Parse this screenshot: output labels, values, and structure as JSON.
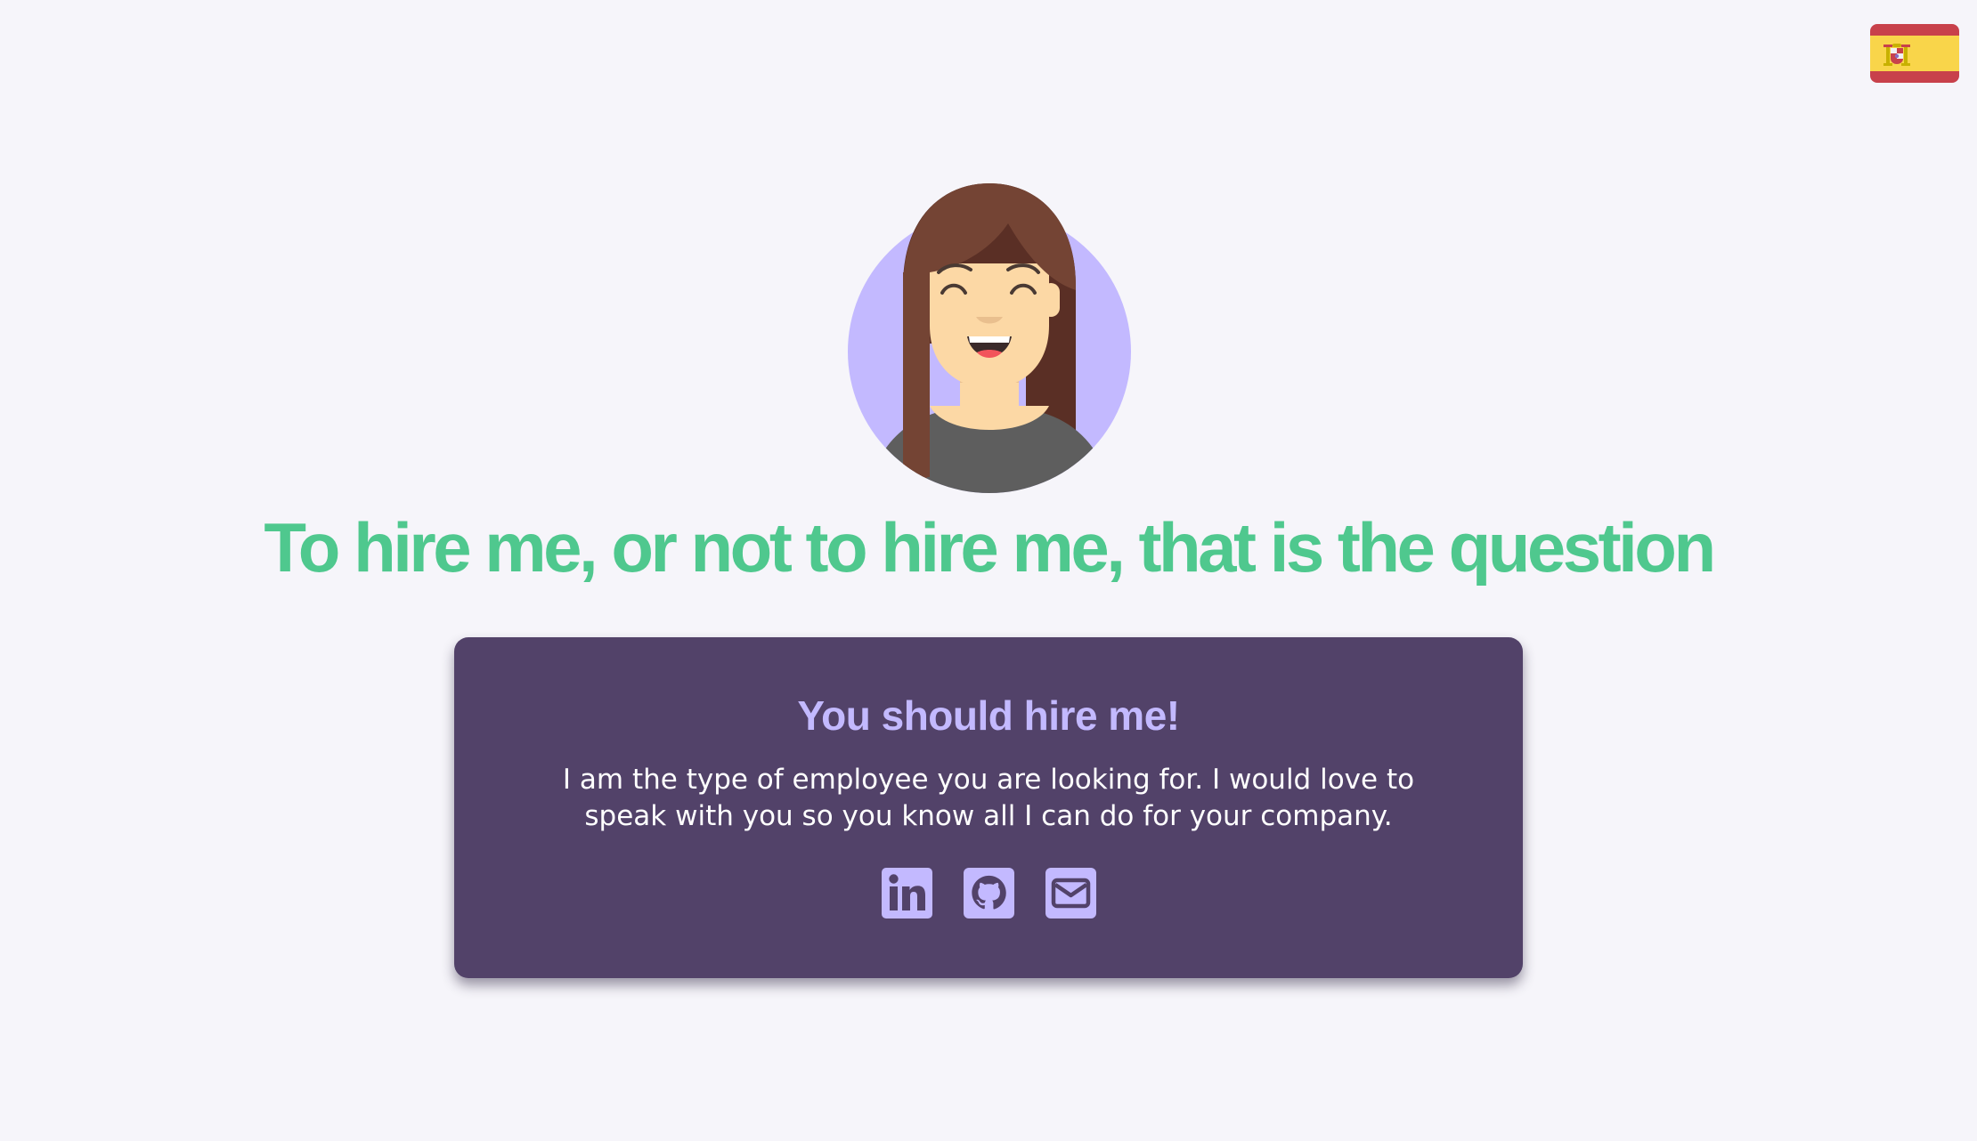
{
  "language_switch": {
    "label": "Español",
    "flag": "spain-flag-icon",
    "colors": {
      "red": "#c8414b",
      "yellow": "#f9d54a"
    }
  },
  "avatar": {
    "icon": "woman-avatar-icon",
    "colors": {
      "circle": "#c3b9ff",
      "hair": "#744434",
      "skin": "#fcd8a5",
      "shirt": "#5e5e5e"
    }
  },
  "headline": "To hire me, or not to hire me, that is the question",
  "card": {
    "title": "You should hire me!",
    "text": "I am the type of employee you are looking for. I would love to speak with you so you know all I can do for your company.",
    "links": [
      {
        "name": "linkedin",
        "icon": "linkedin-icon"
      },
      {
        "name": "github",
        "icon": "github-icon"
      },
      {
        "name": "email",
        "icon": "envelope-icon"
      }
    ]
  },
  "colors": {
    "background": "#f6f5fa",
    "accent": "#4fc88e",
    "card": "#524269",
    "card_title": "#c3b9ff",
    "icon": "#c3b9ff"
  }
}
